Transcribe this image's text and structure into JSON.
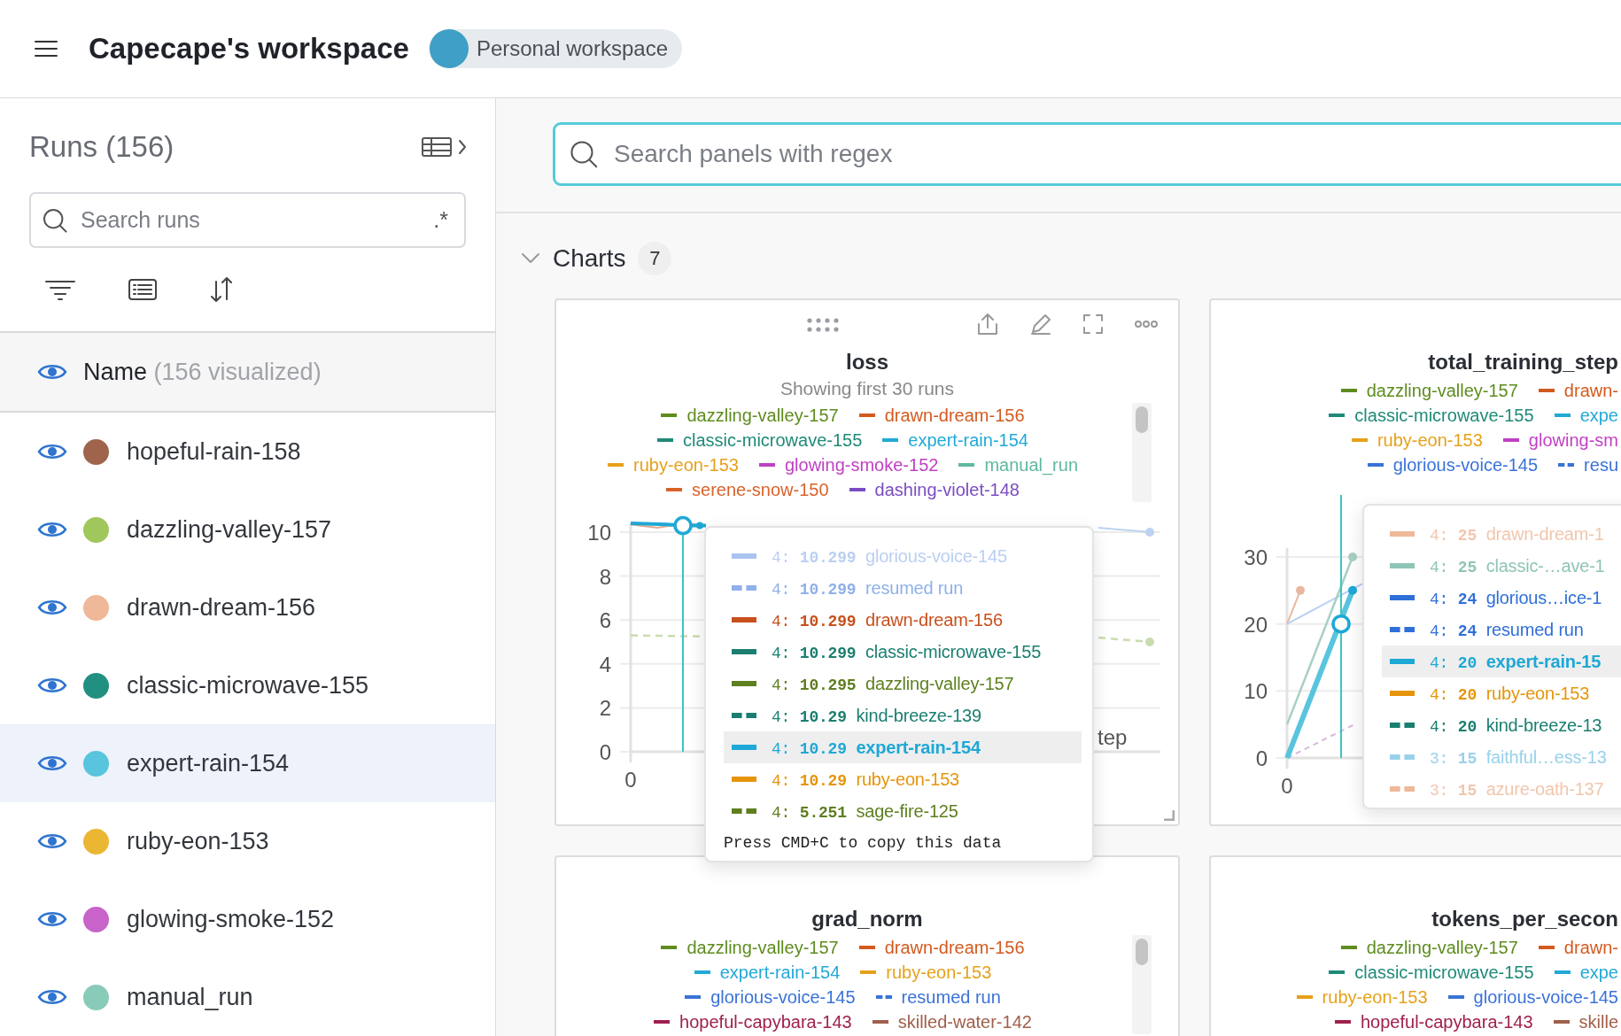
{
  "header": {
    "title": "Capecape's workspace",
    "badge": "Personal workspace"
  },
  "sidebar": {
    "title": "Runs (156)",
    "search": {
      "placeholder": "Search runs",
      "regex_label": ".*"
    },
    "name_header": {
      "label": "Name",
      "count": "(156 visualized)"
    },
    "runs": [
      {
        "name": "hopeful-rain-158",
        "color": "#a0644c",
        "selected": false
      },
      {
        "name": "dazzling-valley-157",
        "color": "#a0c75c",
        "selected": false
      },
      {
        "name": "drawn-dream-156",
        "color": "#eeb899",
        "selected": false
      },
      {
        "name": "classic-microwave-155",
        "color": "#229080",
        "selected": false
      },
      {
        "name": "expert-rain-154",
        "color": "#58c4dd",
        "selected": true
      },
      {
        "name": "ruby-eon-153",
        "color": "#ebb733",
        "selected": false
      },
      {
        "name": "glowing-smoke-152",
        "color": "#c763c9",
        "selected": false
      },
      {
        "name": "manual_run",
        "color": "#88cbb8",
        "selected": false
      }
    ]
  },
  "main": {
    "search": {
      "placeholder": "Search panels with regex"
    },
    "section": {
      "title": "Charts",
      "count": "7",
      "expanded": true
    },
    "panels": [
      {
        "title": "loss",
        "subtitle": "Showing first 30 runs",
        "hovered": true,
        "legend_rows": [
          [
            {
              "name": "dazzling-valley-157",
              "color": "#5e8c1f",
              "dashed": false
            },
            {
              "name": "drawn-dream-156",
              "color": "#d35a1e",
              "dashed": false
            }
          ],
          [
            {
              "name": "classic-microwave-155",
              "color": "#1f8a78",
              "dashed": false
            },
            {
              "name": "expert-rain-154",
              "color": "#22a9d6",
              "dashed": false
            }
          ],
          [
            {
              "name": "ruby-eon-153",
              "color": "#e6a11a",
              "dashed": false
            },
            {
              "name": "glowing-smoke-152",
              "color": "#c040c4",
              "dashed": false
            },
            {
              "name": "manual_run",
              "color": "#5fb8a0",
              "dashed": false
            }
          ],
          [
            {
              "name": "serene-snow-150",
              "color": "#d9622b",
              "dashed": false
            },
            {
              "name": "dashing-violet-148",
              "color": "#7a4cc2",
              "dashed": false
            }
          ]
        ],
        "y_ticks": [
          "10",
          "8",
          "6",
          "4",
          "2",
          "0"
        ],
        "x_ticks": [
          "0"
        ],
        "x_label": "tep",
        "tooltip": {
          "rows": [
            {
              "step": "4:",
              "value": "10.299",
              "name": "glorious-voice-145",
              "color": "#a9c4ee",
              "dashed": false,
              "faded": true,
              "selected": false
            },
            {
              "step": "4:",
              "value": "10.299",
              "name": "resumed run",
              "color": "#8fb0e8",
              "dashed": true,
              "faded": false,
              "selected": false
            },
            {
              "step": "4:",
              "value": "10.299",
              "name": "drawn-dream-156",
              "color": "#c8501c",
              "dashed": false,
              "faded": false,
              "selected": false
            },
            {
              "step": "4:",
              "value": "10.299",
              "name": "classic-microwave-155",
              "color": "#1a7f70",
              "dashed": false,
              "faded": false,
              "selected": false
            },
            {
              "step": "4:",
              "value": "10.295",
              "name": "dazzling-valley-157",
              "color": "#5e7f1f",
              "dashed": false,
              "faded": false,
              "selected": false
            },
            {
              "step": "4:",
              "value": "10.29",
              "name": "kind-breeze-139",
              "color": "#1a7f70",
              "dashed": true,
              "faded": false,
              "selected": false
            },
            {
              "step": "4:",
              "value": "10.29",
              "name": "expert-rain-154",
              "color": "#1ea8d6",
              "dashed": false,
              "faded": false,
              "selected": true
            },
            {
              "step": "4:",
              "value": "10.29",
              "name": "ruby-eon-153",
              "color": "#e6950a",
              "dashed": false,
              "faded": false,
              "selected": false
            },
            {
              "step": "4:",
              "value": "5.251",
              "name": "sage-fire-125",
              "color": "#5e7f1f",
              "dashed": true,
              "faded": false,
              "selected": false
            }
          ],
          "footer": "Press CMD+C to copy this data"
        }
      },
      {
        "title": "total_training_step",
        "hovered": false,
        "legend_rows": [
          [
            {
              "name": "dazzling-valley-157",
              "color": "#5e8c1f",
              "dashed": false
            },
            {
              "name": "drawn-",
              "color": "#d35a1e",
              "dashed": false
            }
          ],
          [
            {
              "name": "classic-microwave-155",
              "color": "#1f8a78",
              "dashed": false
            },
            {
              "name": "expe",
              "color": "#22a9d6",
              "dashed": false
            }
          ],
          [
            {
              "name": "ruby-eon-153",
              "color": "#e6a11a",
              "dashed": false
            },
            {
              "name": "glowing-sm",
              "color": "#c040c4",
              "dashed": false
            }
          ],
          [
            {
              "name": "glorious-voice-145",
              "color": "#3a72d8",
              "dashed": false
            },
            {
              "name": "resu",
              "color": "#3a72d8",
              "dashed": true
            }
          ]
        ],
        "y_ticks": [
          "30",
          "20",
          "10",
          "0"
        ],
        "x_ticks": [
          "0"
        ],
        "tooltip": {
          "rows": [
            {
              "step": "4:",
              "value": "25",
              "name": "drawn-dream-1",
              "color": "#eeb899",
              "dashed": false,
              "faded": true,
              "selected": false
            },
            {
              "step": "4:",
              "value": "25",
              "name": "classic-…ave-1",
              "color": "#8fc4b6",
              "dashed": false,
              "faded": false,
              "selected": false
            },
            {
              "step": "4:",
              "value": "24",
              "name": "glorious…ice-1",
              "color": "#2f6fd8",
              "dashed": false,
              "faded": false,
              "selected": false
            },
            {
              "step": "4:",
              "value": "24",
              "name": "resumed run",
              "color": "#2f6fd8",
              "dashed": true,
              "faded": false,
              "selected": false
            },
            {
              "step": "4:",
              "value": "20",
              "name": "expert-rain-15",
              "color": "#1ea8d6",
              "dashed": false,
              "faded": false,
              "selected": true
            },
            {
              "step": "4:",
              "value": "20",
              "name": "ruby-eon-153",
              "color": "#e6950a",
              "dashed": false,
              "faded": false,
              "selected": false
            },
            {
              "step": "4:",
              "value": "20",
              "name": "kind-breeze-13",
              "color": "#1a7f70",
              "dashed": true,
              "faded": false,
              "selected": false
            },
            {
              "step": "3:",
              "value": "15",
              "name": "faithful…ess-13",
              "color": "#9ad1ea",
              "dashed": true,
              "faded": false,
              "selected": false
            },
            {
              "step": "3:",
              "value": "15",
              "name": "azure-oath-137",
              "color": "#eeb899",
              "dashed": true,
              "faded": true,
              "selected": false
            }
          ]
        }
      },
      {
        "title": "grad_norm",
        "hovered": false,
        "legend_rows": [
          [
            {
              "name": "dazzling-valley-157",
              "color": "#5e8c1f",
              "dashed": false
            },
            {
              "name": "drawn-dream-156",
              "color": "#d35a1e",
              "dashed": false
            }
          ],
          [
            {
              "name": "expert-rain-154",
              "color": "#22a9d6",
              "dashed": false
            },
            {
              "name": "ruby-eon-153",
              "color": "#e6a11a",
              "dashed": false
            }
          ],
          [
            {
              "name": "glorious-voice-145",
              "color": "#3a72d8",
              "dashed": false
            },
            {
              "name": "resumed run",
              "color": "#3a72d8",
              "dashed": true
            }
          ],
          [
            {
              "name": "hopeful-capybara-143",
              "color": "#a0204f",
              "dashed": false
            },
            {
              "name": "skilled-water-142",
              "color": "#a0604a",
              "dashed": false
            }
          ]
        ]
      },
      {
        "title": "tokens_per_secon",
        "hovered": false,
        "legend_rows": [
          [
            {
              "name": "dazzling-valley-157",
              "color": "#5e8c1f",
              "dashed": false
            },
            {
              "name": "drawn-",
              "color": "#d35a1e",
              "dashed": false
            }
          ],
          [
            {
              "name": "classic-microwave-155",
              "color": "#1f8a78",
              "dashed": false
            },
            {
              "name": "expe",
              "color": "#22a9d6",
              "dashed": false
            }
          ],
          [
            {
              "name": "ruby-eon-153",
              "color": "#e6a11a",
              "dashed": false
            },
            {
              "name": "glorious-voice-145",
              "color": "#3a72d8",
              "dashed": false
            }
          ],
          [
            {
              "name": "hopeful-capybara-143",
              "color": "#a0204f",
              "dashed": false
            },
            {
              "name": "skille",
              "color": "#a0604a",
              "dashed": false
            }
          ]
        ]
      }
    ]
  }
}
